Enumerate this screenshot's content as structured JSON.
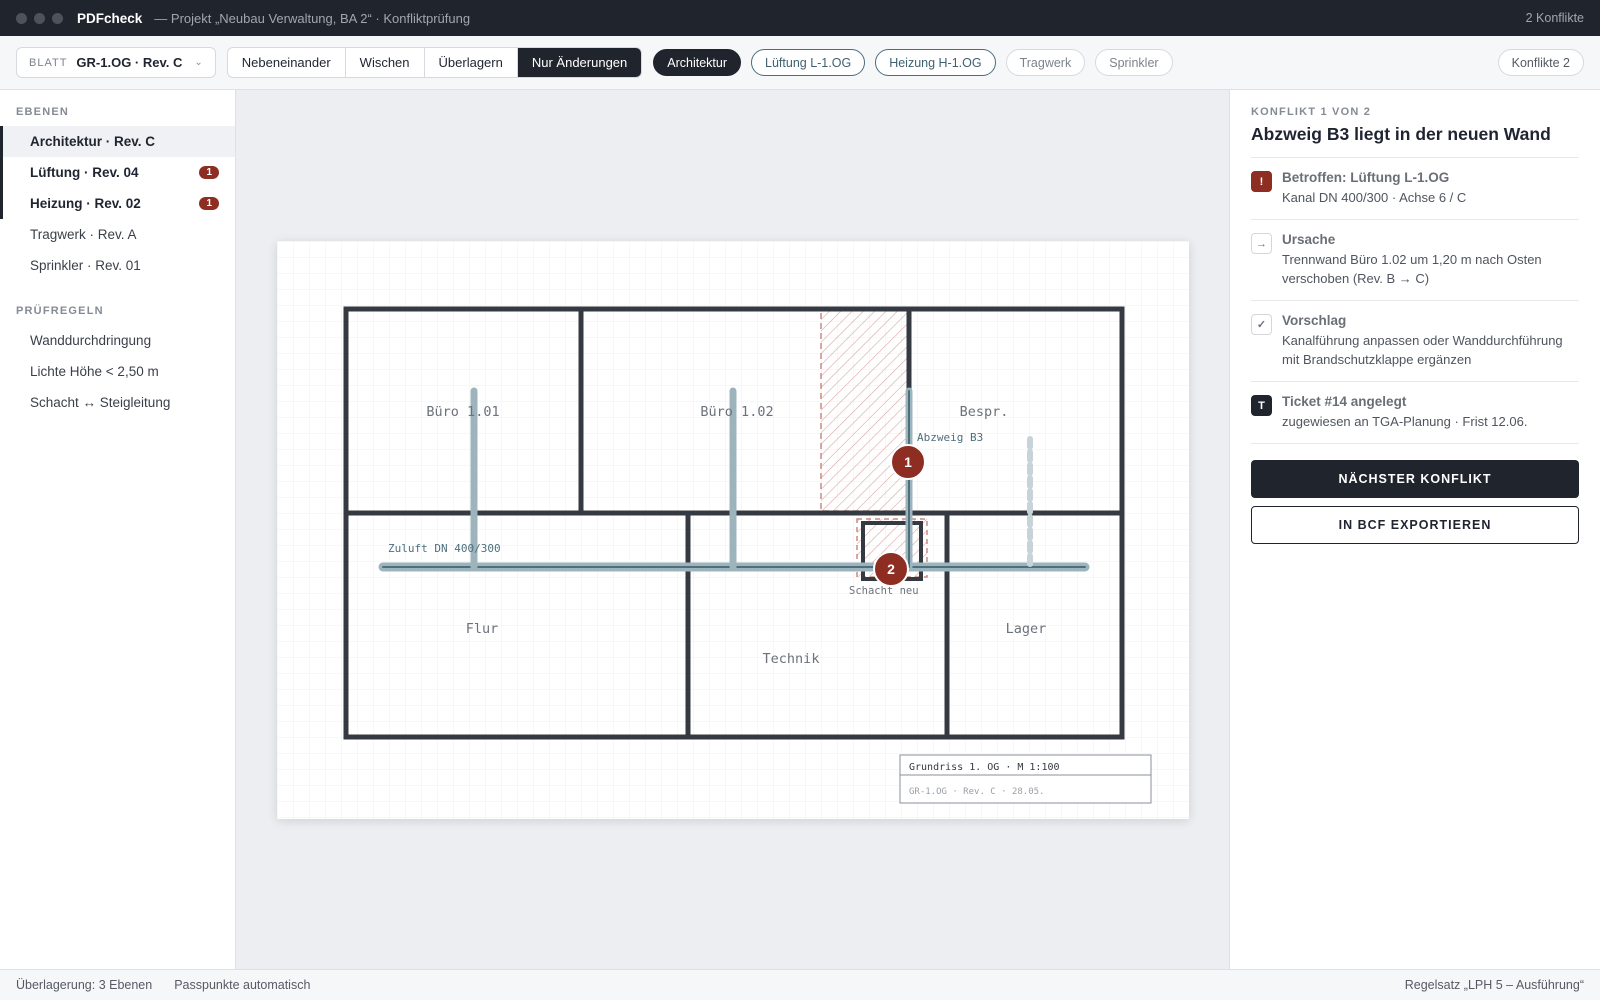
{
  "titlebar": {
    "app_name": "PDFcheck",
    "document": "— Projekt „Neubau Verwaltung, BA 2“ · Konfliktprüfung",
    "conflicts_count": "2 Konflikte"
  },
  "toolbar": {
    "sheet_caption": "BLATT",
    "sheet_value": "GR-1.OG · Rev. C",
    "view_modes": [
      "Nebeneinander",
      "Wischen",
      "Überlagern",
      "Nur Änderungen"
    ],
    "active_view_mode": "Nur Änderungen",
    "filters": [
      "Architektur",
      "Lüftung L-1.OG",
      "Heizung H-1.OG",
      "Tragwerk",
      "Sprinkler"
    ],
    "conflicts_chip": "Konflikte 2"
  },
  "sidebar": {
    "layers_title": "EBENEN",
    "layers": [
      {
        "label": "Architektur · Rev. C",
        "badge": ""
      },
      {
        "label": "Lüftung · Rev. 04",
        "badge": "1"
      },
      {
        "label": "Heizung · Rev. 02",
        "badge": "1"
      },
      {
        "label": "Tragwerk · Rev. A",
        "badge": ""
      },
      {
        "label": "Sprinkler · Rev. 01",
        "badge": ""
      }
    ],
    "rules_title": "PRÜFREGELN",
    "rules": [
      "Wanddurchdringung",
      "Lichte Höhe < 2,50 m",
      "Schacht ↔ Steigleitung"
    ]
  },
  "drawing": {
    "rooms": [
      "Büro 1.01",
      "Büro 1.02",
      "Bespr.",
      "Flur",
      "Technik",
      "Lager"
    ],
    "duct_label": "Zuluft DN 400/300",
    "branch_label": "Abzweig B3",
    "shaft_label": "Schacht neu",
    "markers": [
      "1",
      "2"
    ],
    "title_block": {
      "title": "Grundriss 1. OG · M 1:100",
      "sub": "GR-1.OG · Rev. C · 28.05."
    },
    "colors": {
      "wall": "#353a42",
      "duct": "#9db4bd",
      "marker": "#8e2e22",
      "conflict_hatch": "#c98b86"
    }
  },
  "panel": {
    "caption": "KONFLIKT 1 VON 2",
    "title": "Abzweig B3 liegt in der neuen Wand",
    "items": [
      {
        "icon": "!",
        "title": "Betroffen: Lüftung L-1.OG",
        "body": "Kanal DN 400/300 · Achse 6 / C"
      },
      {
        "icon": "→",
        "title": "Ursache",
        "body": "Trennwand Büro 1.02 um 1,20 m nach Osten verschoben (Rev. B → C)"
      },
      {
        "icon": "✓",
        "title": "Vorschlag",
        "body": "Kanalführung anpassen oder Wanddurchführung mit Brandschutzklappe ergänzen"
      },
      {
        "icon": "T",
        "title": "Ticket #14 angelegt",
        "body": "zugewiesen an TGA-Planung · Frist 12.06."
      }
    ],
    "primary_button": "NÄCHSTER KONFLIKT",
    "secondary_button": "IN BCF EXPORTIEREN"
  },
  "statusbar": {
    "overlay": "Überlagerung: 3 Ebenen",
    "registration": "Passpunkte automatisch",
    "ruleset": "Regelsatz „LPH 5 – Ausführung“"
  }
}
